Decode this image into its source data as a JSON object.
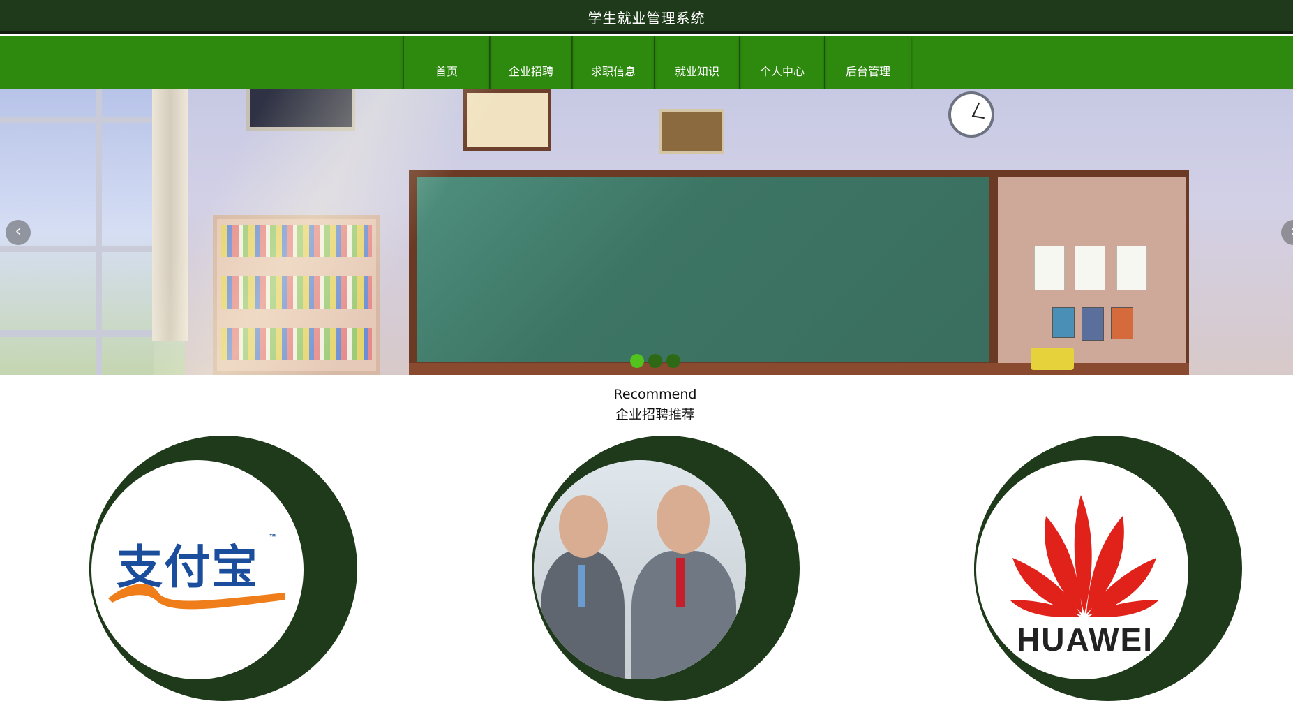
{
  "header": {
    "title": "学生就业管理系统"
  },
  "nav": {
    "items": [
      {
        "label": "首页"
      },
      {
        "label": "企业招聘"
      },
      {
        "label": "求职信息"
      },
      {
        "label": "就业知识"
      },
      {
        "label": "个人中心"
      },
      {
        "label": "后台管理"
      }
    ]
  },
  "carousel": {
    "prev_icon": "chevron-left-icon",
    "next_icon": "chevron-right-icon",
    "prev_glyph": "‹",
    "next_glyph": "›",
    "slide_count": 3,
    "active_index": 0
  },
  "section": {
    "title_en": "Recommend",
    "title_zh": "企业招聘推荐"
  },
  "cards": [
    {
      "image": "alipay-logo",
      "logo_text": "支付宝",
      "tm": "™"
    },
    {
      "image": "business-meeting-photo"
    },
    {
      "image": "huawei-logo",
      "logo_text": "HUAWEI"
    }
  ],
  "colors": {
    "header_bg": "#1e3a1a",
    "nav_bg": "#2e8a0f",
    "dot_active": "#52c21c",
    "dot_inactive": "#2e6a16",
    "card_accent": "#1e3a1a",
    "huawei_red": "#e0221b",
    "alipay_blue": "#1a4d9c",
    "alipay_orange": "#ef7d1a"
  }
}
